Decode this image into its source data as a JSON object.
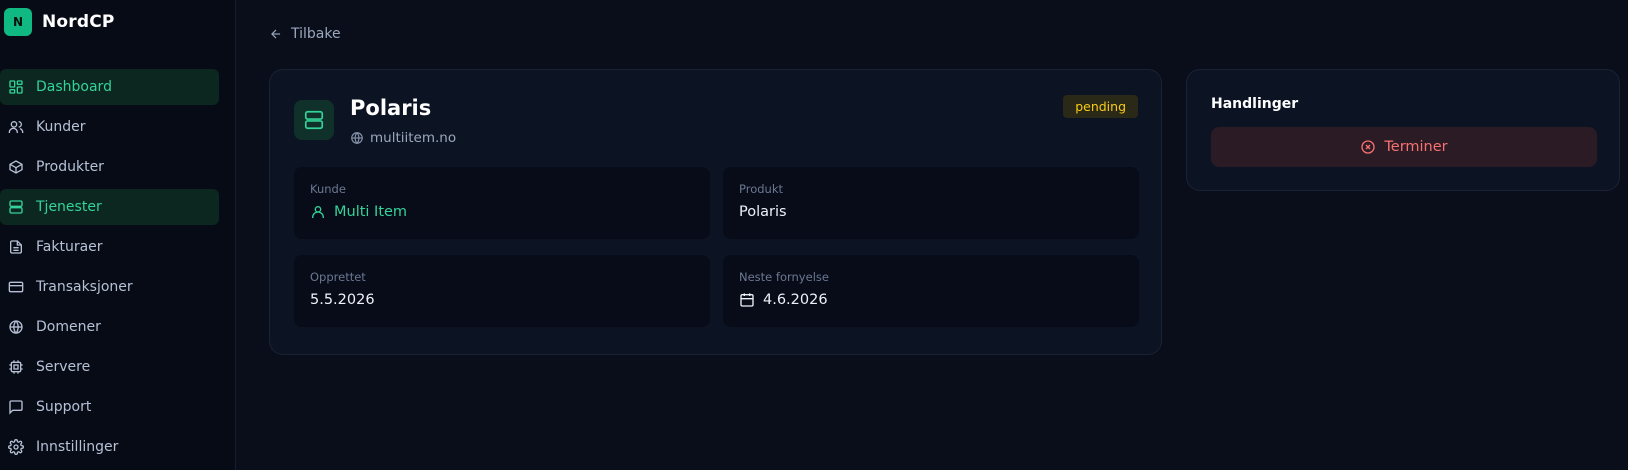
{
  "brand": {
    "logo_letter": "N",
    "name": "NordCP"
  },
  "sidebar": {
    "items": [
      {
        "label": "Dashboard",
        "icon": "dashboard-icon",
        "active": true
      },
      {
        "label": "Kunder",
        "icon": "users-icon",
        "active": false
      },
      {
        "label": "Produkter",
        "icon": "package-icon",
        "active": false
      },
      {
        "label": "Tjenester",
        "icon": "server-icon",
        "active": true
      },
      {
        "label": "Fakturaer",
        "icon": "file-text-icon",
        "active": false
      },
      {
        "label": "Transaksjoner",
        "icon": "credit-card-icon",
        "active": false
      },
      {
        "label": "Domener",
        "icon": "globe-icon",
        "active": false
      },
      {
        "label": "Servere",
        "icon": "cpu-icon",
        "active": false
      },
      {
        "label": "Support",
        "icon": "message-icon",
        "active": false
      },
      {
        "label": "Innstillinger",
        "icon": "gear-icon",
        "active": false
      }
    ]
  },
  "back_label": "Tilbake",
  "service": {
    "title": "Polaris",
    "domain": "multiitem.no",
    "status": "pending",
    "fields": {
      "customer": {
        "label": "Kunde",
        "value": "Multi Item"
      },
      "product": {
        "label": "Produkt",
        "value": "Polaris"
      },
      "created": {
        "label": "Opprettet",
        "value": "5.5.2026"
      },
      "renewal": {
        "label": "Neste fornyelse",
        "value": "4.6.2026"
      }
    }
  },
  "actions": {
    "title": "Handlinger",
    "terminate_label": "Terminer"
  },
  "colors": {
    "accent": "#34d399",
    "danger": "#f87171",
    "warning": "#facc15",
    "background": "#090e1a"
  }
}
